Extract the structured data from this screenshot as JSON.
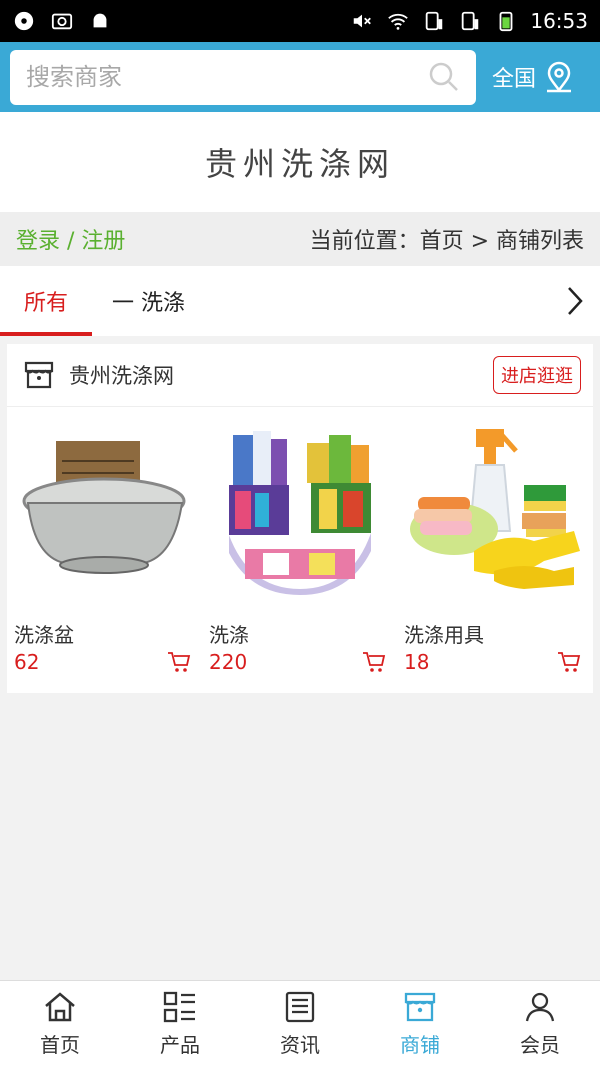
{
  "status_bar": {
    "time": "16:53"
  },
  "search": {
    "placeholder": "搜索商家",
    "region_label": "全国"
  },
  "site": {
    "title": "贵州洗涤网"
  },
  "login_bar": {
    "login_text": "登录 / 注册",
    "breadcrumb": "当前位置：首页 > 商铺列表"
  },
  "tabs": {
    "all": "所有",
    "category": "一 洗涤"
  },
  "shop": {
    "name": "贵州洗涤网",
    "visit_label": "进店逛逛",
    "products": [
      {
        "name": "洗涤盆",
        "price": "62"
      },
      {
        "name": "洗涤",
        "price": "220"
      },
      {
        "name": "洗涤用具",
        "price": "18"
      }
    ]
  },
  "nav": {
    "items": [
      {
        "label": "首页",
        "icon": "home-icon"
      },
      {
        "label": "产品",
        "icon": "grid-icon"
      },
      {
        "label": "资讯",
        "icon": "news-icon"
      },
      {
        "label": "商铺",
        "icon": "store-icon"
      },
      {
        "label": "会员",
        "icon": "user-icon"
      }
    ],
    "active_index": 3,
    "active_color": "#3aa9d6"
  },
  "colors": {
    "accent": "#3aa9d6",
    "price_red": "#d81e1e",
    "login_green": "#5ab030"
  }
}
